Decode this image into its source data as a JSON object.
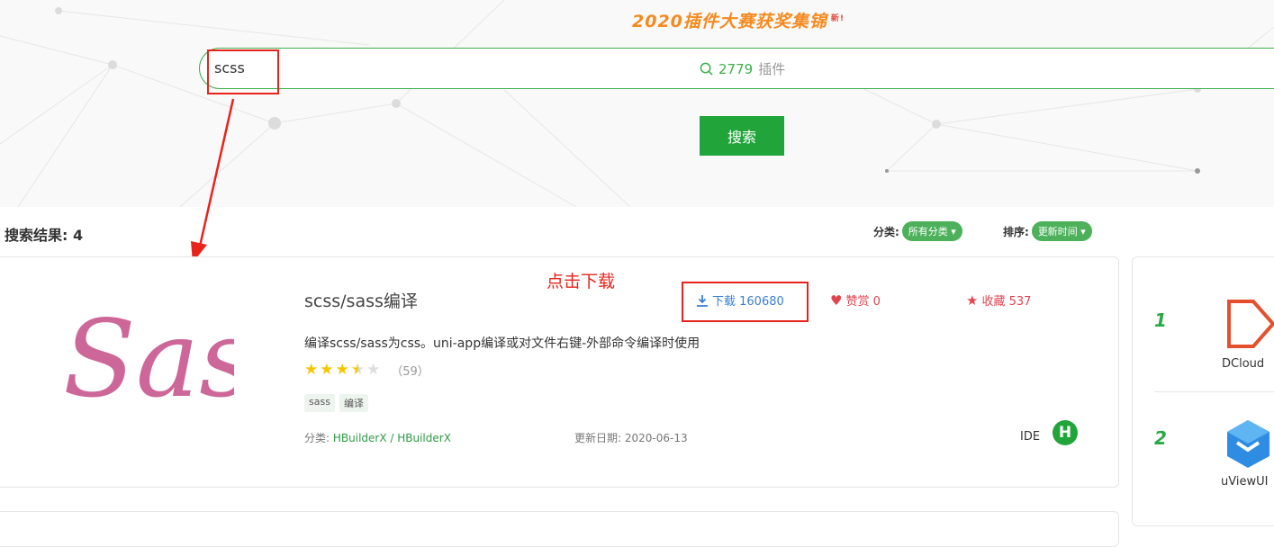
{
  "banner": {
    "title": "2020插件大赛获奖集锦",
    "badge": "新!"
  },
  "search": {
    "value": "scss",
    "hint_count": "2779",
    "hint_unit": "插件",
    "button_label": "搜索"
  },
  "results": {
    "label": "搜索结果: 4"
  },
  "filters": {
    "category_label": "分类:",
    "category_value": "所有分类",
    "sort_label": "排序:",
    "sort_value": "更新时间"
  },
  "annotation": "点击下载",
  "plugin": {
    "logo_text": "Sass",
    "title": "scss/sass编译",
    "description": "编译scss/sass为css。uni-app编译或对文件右键-外部命令编译时使用",
    "rating": 3.5,
    "rating_count": "（59）",
    "tags": [
      "sass",
      "编译"
    ],
    "download_label": "下载 160680",
    "reward_label": "赞赏 0",
    "favorite_label": "收藏 537",
    "category_prefix": "分类:",
    "category_link": "HBuilderX / HBuilderX",
    "update_date": "更新日期: 2020-06-13",
    "platform": "IDE",
    "platform_badge": "H"
  },
  "sidebar": {
    "items": [
      {
        "rank": "1",
        "name": "DCloud"
      },
      {
        "rank": "2",
        "name": "uViewUI"
      }
    ]
  },
  "colors": {
    "accent": "#21a53b",
    "annotation": "#e8231c",
    "download": "#3a7fd5",
    "reward": "#e0444e"
  }
}
